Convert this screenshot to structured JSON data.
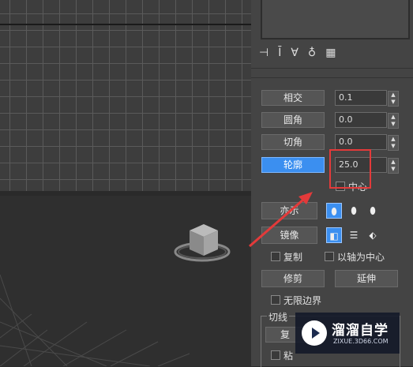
{
  "panel": {
    "buttons": {
      "intersect": "相交",
      "fillet": "圆角",
      "chamfer": "切角",
      "outline": "轮廓",
      "mirror_left": "镜像",
      "trim": "修剪",
      "extend": "延伸",
      "cut_button": "复",
      "display_left": "亦示"
    },
    "spinners": {
      "intersect_value": "0.1",
      "fillet_value": "0.0",
      "chamfer_value": "0.0",
      "outline_value": "25.0"
    },
    "checkboxes": {
      "center": "中心",
      "copy": "复制",
      "about_pivot": "以轴为中心",
      "infinite_bounds": "无限边界",
      "bind_partial": "粘"
    },
    "group_title": "切线"
  },
  "icons": {
    "toolbar": [
      "pin-icon",
      "hammer-icon",
      "modifier-stack-icon",
      "remove-modifier-icon",
      "configure-sets-icon"
    ],
    "mirror_modes": [
      "mirror-horizontal-icon",
      "mirror-vertical-icon",
      "mirror-both-icon"
    ],
    "display_modes": [
      "display-mode-1-icon",
      "display-mode-2-icon",
      "display-mode-3-icon"
    ]
  },
  "annotation": {
    "highlight_color": "#e33a3a",
    "arrow_color": "#e33a3a",
    "active_button_color": "#3b8ff0"
  },
  "watermark": {
    "title": "溜溜自学",
    "url": "ZIXUE.3D66.COM"
  }
}
